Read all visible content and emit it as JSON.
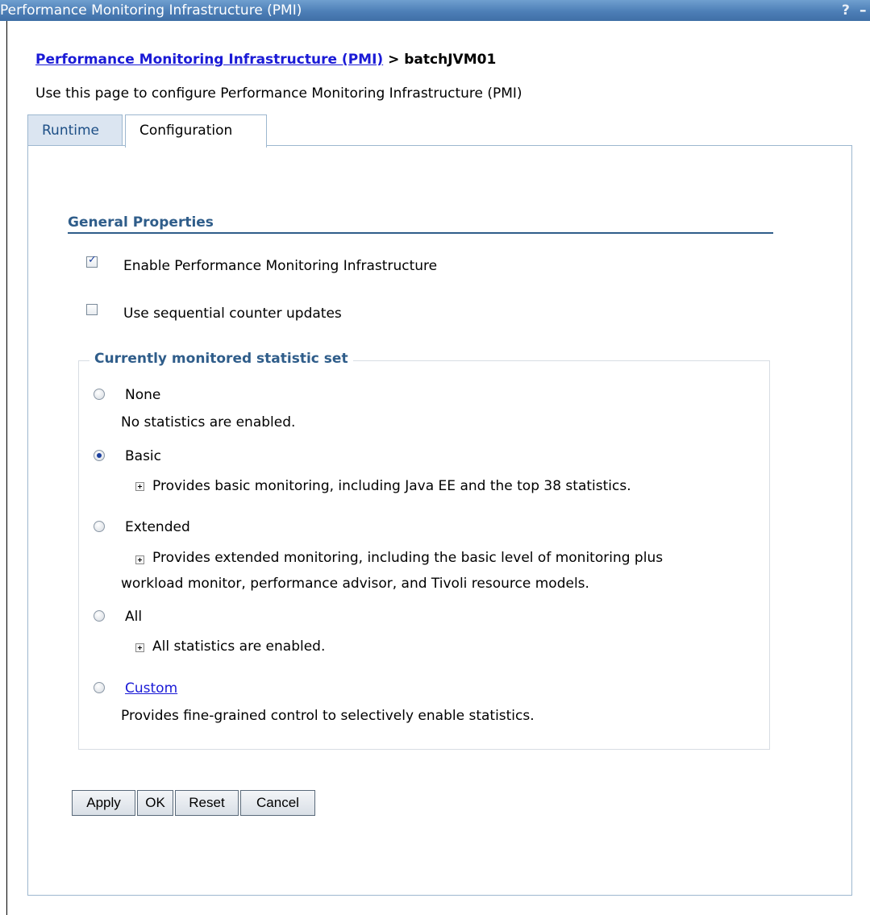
{
  "window": {
    "title": "Performance Monitoring Infrastructure (PMI)",
    "help_glyph": "?",
    "minimize_glyph": "–"
  },
  "breadcrumb": {
    "link": "Performance Monitoring Infrastructure (PMI)",
    "separator": " > ",
    "current": "batchJVM01"
  },
  "description": "Use this page to configure Performance Monitoring Infrastructure (PMI)",
  "tabs": {
    "runtime": "Runtime",
    "configuration": "Configuration",
    "active": "Configuration"
  },
  "general_properties": {
    "heading": "General Properties",
    "enable_pmi": {
      "label": "Enable Performance Monitoring Infrastructure",
      "checked": true
    },
    "sequential_updates": {
      "label": "Use sequential counter updates",
      "checked": false
    }
  },
  "statistic_set": {
    "legend": "Currently monitored statistic set",
    "selected": "Basic",
    "options": {
      "none": {
        "label": "None",
        "description": "No statistics are enabled."
      },
      "basic": {
        "label": "Basic",
        "description": "Provides basic monitoring, including Java EE and the top 38 statistics."
      },
      "extended": {
        "label": "Extended",
        "description_line1": "Provides extended monitoring, including the basic level of monitoring plus",
        "description_line2": "workload monitor, performance advisor, and Tivoli resource models."
      },
      "all": {
        "label": "All",
        "description": "All statistics are enabled."
      },
      "custom": {
        "label": "Custom",
        "description": "Provides fine-grained control to selectively enable statistics."
      }
    }
  },
  "buttons": {
    "apply": "Apply",
    "ok": "OK",
    "reset": "Reset",
    "cancel": "Cancel"
  },
  "colors": {
    "titlebar": "#4d7fb7",
    "heading": "#2f5d8a",
    "link": "#1a1ad6",
    "tab_inactive_bg": "#dbe5f1",
    "panel_border": "#9db7cf"
  },
  "icons": {
    "checkbox_checked": "checkmark-icon",
    "expand": "plus-expand-icon"
  }
}
